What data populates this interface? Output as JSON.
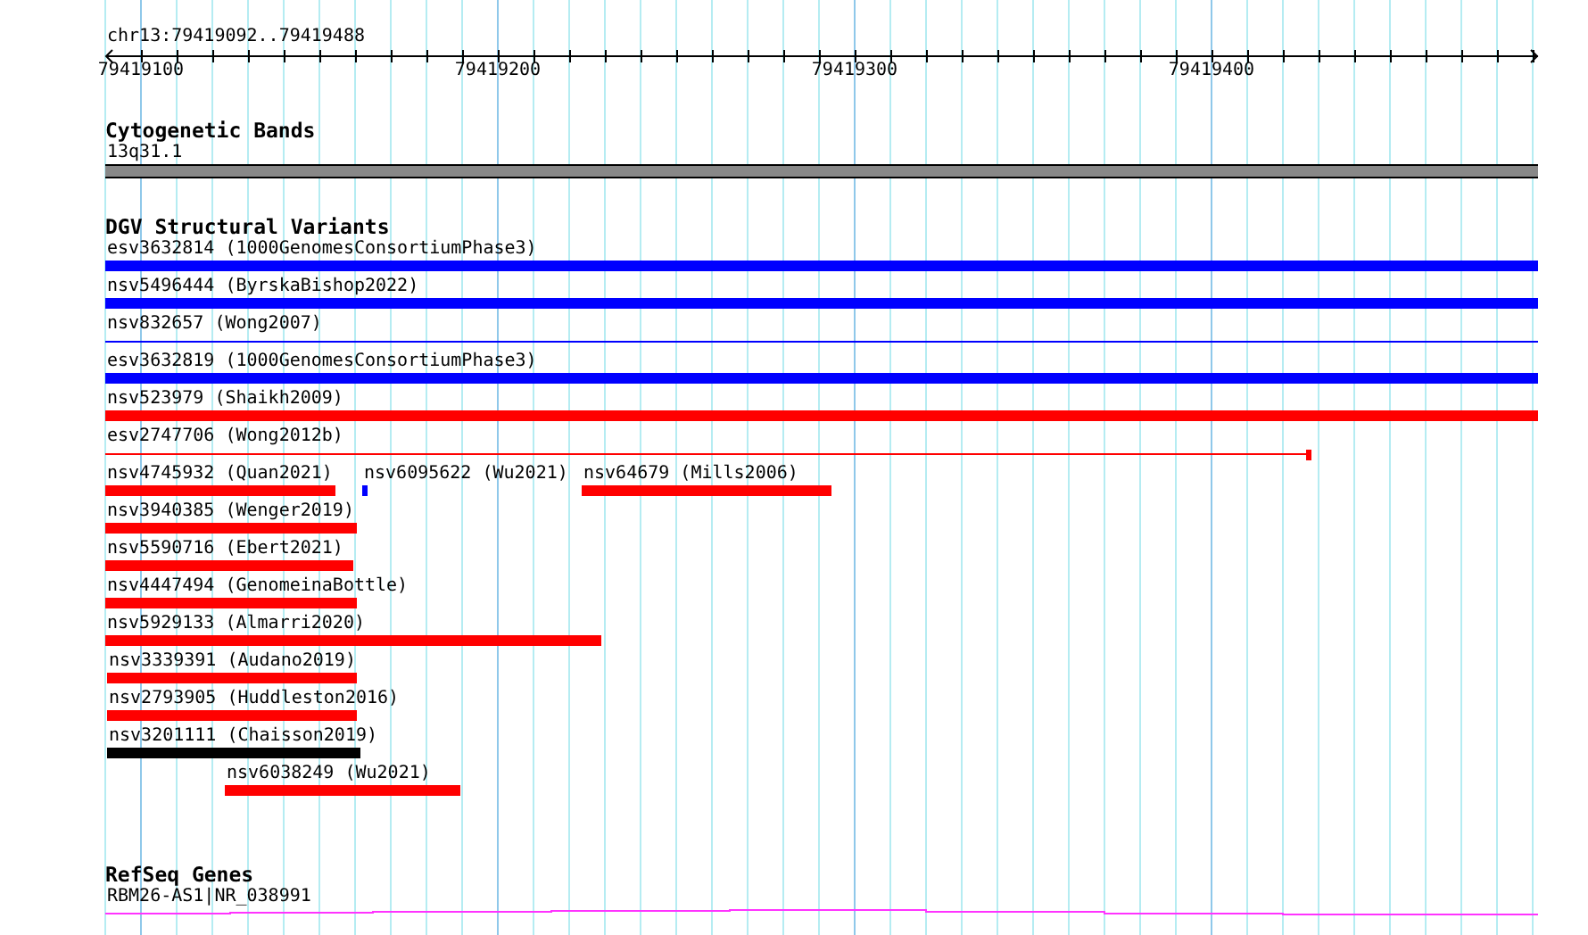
{
  "ruler": {
    "location": "chr13:79419092..79419488",
    "tick_labels": [
      "79419100",
      "79419200",
      "79419300",
      "79419400"
    ]
  },
  "tracks": [
    {
      "kind": "bands",
      "title": "Cytogenetic Bands",
      "band_label": "13q31.1"
    },
    {
      "kind": "variants",
      "title": "DGV Structural Variants",
      "rows": [
        {
          "features": [
            {
              "label": "esv3632814 (1000GenomesConsortiumPhase3)",
              "kind": "bar",
              "color": "#0000ff"
            }
          ]
        },
        {
          "features": [
            {
              "label": "nsv5496444 (ByrskaBishop2022)",
              "kind": "bar",
              "color": "#0000ff"
            }
          ]
        },
        {
          "features": [
            {
              "label": "nsv832657 (Wong2007)",
              "kind": "line",
              "color": "#0000ff"
            }
          ]
        },
        {
          "features": [
            {
              "label": "esv3632819 (1000GenomesConsortiumPhase3)",
              "kind": "bar",
              "color": "#0000ff"
            }
          ]
        },
        {
          "features": [
            {
              "label": "nsv523979 (Shaikh2009)",
              "kind": "bar",
              "color": "#ff0000"
            }
          ]
        },
        {
          "features": [
            {
              "label": "esv2747706 (Wong2012b)",
              "kind": "line",
              "color": "#ff0000"
            }
          ]
        },
        {
          "features": [
            {
              "label": "nsv4745932 (Quan2021)",
              "kind": "bar",
              "color": "#ff0000"
            },
            {
              "label": "nsv6095622 (Wu2021)",
              "kind": "bar",
              "color": "#0000ff"
            },
            {
              "label": "nsv64679 (Mills2006)",
              "kind": "bar",
              "color": "#ff0000"
            }
          ]
        },
        {
          "features": [
            {
              "label": "nsv3940385 (Wenger2019)",
              "kind": "bar",
              "color": "#ff0000"
            }
          ]
        },
        {
          "features": [
            {
              "label": "nsv5590716 (Ebert2021)",
              "kind": "bar",
              "color": "#ff0000"
            }
          ]
        },
        {
          "features": [
            {
              "label": "nsv4447494 (GenomeinaBottle)",
              "kind": "bar",
              "color": "#ff0000"
            }
          ]
        },
        {
          "features": [
            {
              "label": "nsv5929133 (Almarri2020)",
              "kind": "bar",
              "color": "#ff0000"
            }
          ]
        },
        {
          "features": [
            {
              "label": "nsv3339391 (Audano2019)",
              "kind": "bar",
              "color": "#ff0000"
            }
          ]
        },
        {
          "features": [
            {
              "label": "nsv2793905 (Huddleston2016)",
              "kind": "bar",
              "color": "#ff0000"
            }
          ]
        },
        {
          "features": [
            {
              "label": "nsv3201111 (Chaisson2019)",
              "kind": "bar",
              "color": "#000000"
            }
          ]
        },
        {
          "features": [
            {
              "label": "nsv6038249 (Wu2021)",
              "kind": "bar",
              "color": "#ff0000"
            }
          ]
        }
      ]
    },
    {
      "kind": "genes",
      "title": "RefSeq Genes",
      "gene_label": "RBM26-AS1|NR_038991"
    }
  ]
}
